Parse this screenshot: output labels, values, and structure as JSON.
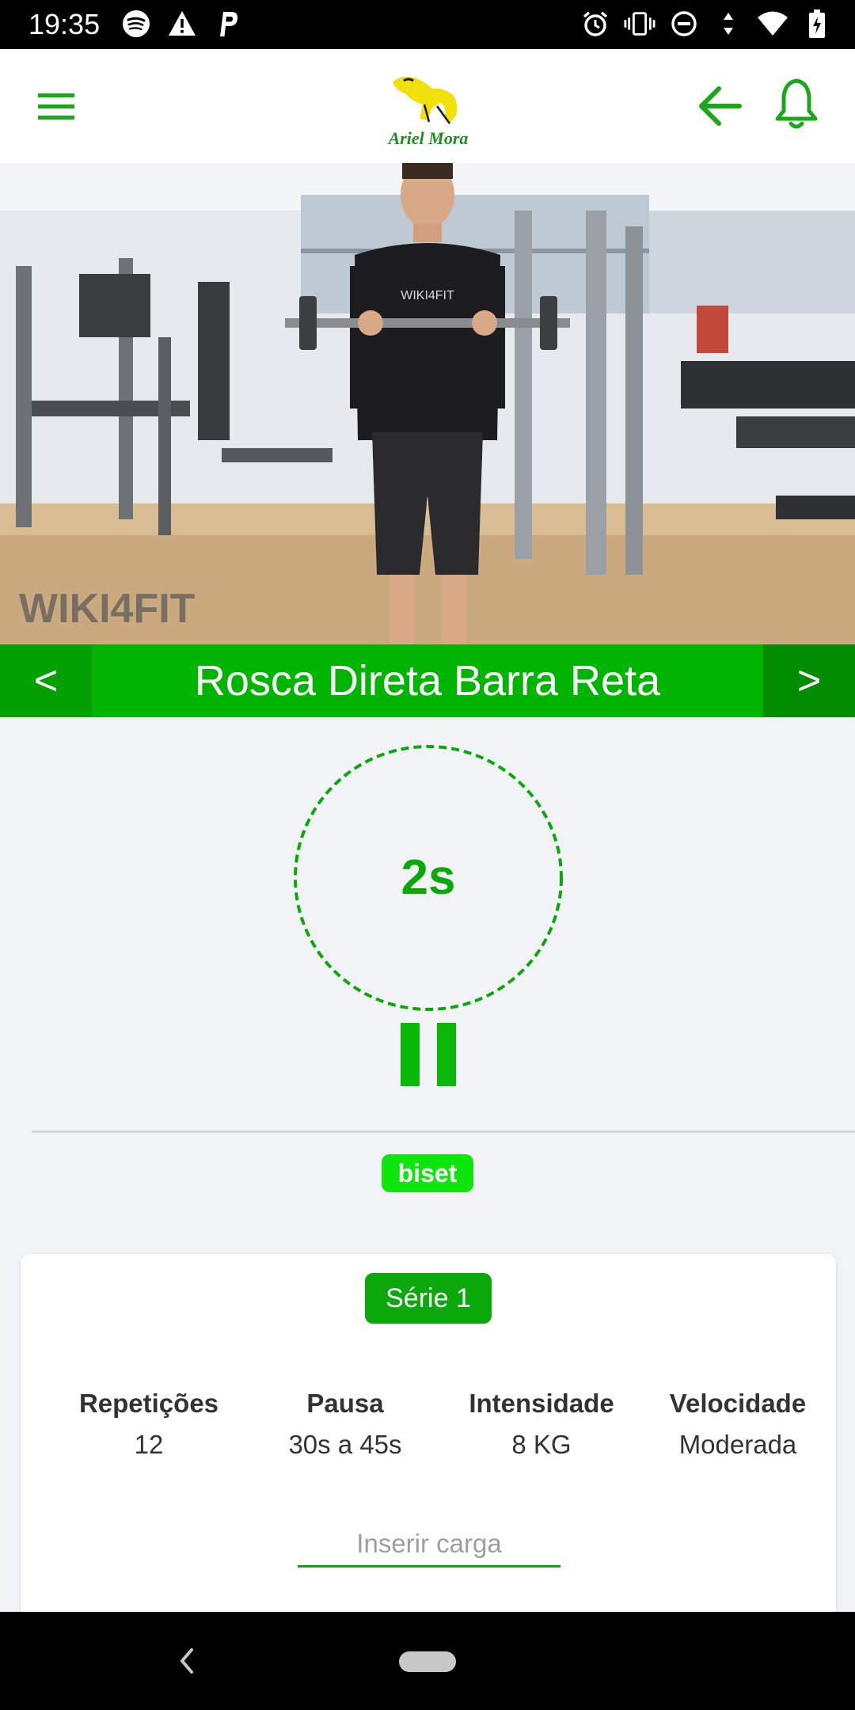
{
  "status_bar": {
    "time": "19:35",
    "left_icons": [
      "spotify-icon",
      "warning-icon",
      "parking-icon"
    ],
    "right_icons": [
      "alarm-icon",
      "vibrate-icon",
      "do-not-disturb-icon",
      "data-arrows-icon",
      "wifi-icon",
      "battery-icon"
    ]
  },
  "header": {
    "logo_text": "Ariel Mora",
    "icons": {
      "menu": "menu-icon",
      "back": "arrow-left-icon",
      "notifications": "bell-icon"
    }
  },
  "video": {
    "watermark": "WIKI4FIT",
    "shirt_text": "WIKI4FIT"
  },
  "exercise": {
    "prev_label": "<",
    "title": "Rosca Direta Barra Reta",
    "next_label": ">"
  },
  "timer": {
    "value": "2s"
  },
  "biset_label": "biset",
  "card": {
    "serie_label": "Série 1",
    "stats": [
      {
        "label": "Repetições",
        "value": "12"
      },
      {
        "label": "Pausa",
        "value": "30s a 45s"
      },
      {
        "label": "Intensidade",
        "value": "8 KG"
      },
      {
        "label": "Velocidade",
        "value": "Moderada"
      }
    ],
    "load_placeholder": "Inserir carga"
  },
  "colors": {
    "primary_green": "#02b402",
    "dark_green": "#0aa80a",
    "badge_green": "#0ee60e",
    "background": "#f2f3f7"
  }
}
